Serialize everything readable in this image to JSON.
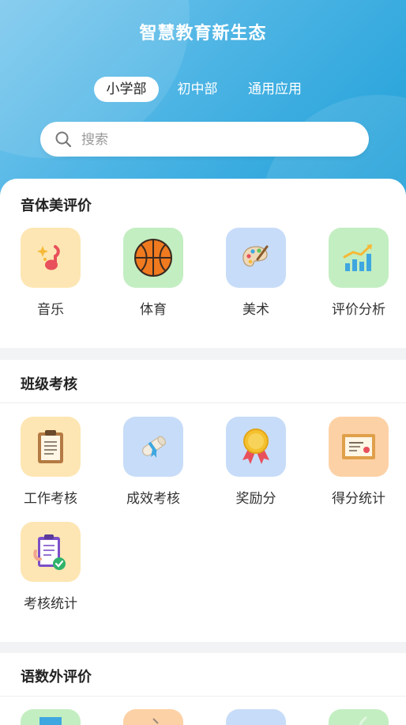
{
  "header": {
    "title": "智慧教育新生态"
  },
  "tabs": [
    {
      "label": "小学部",
      "active": true
    },
    {
      "label": "初中部",
      "active": false
    },
    {
      "label": "通用应用",
      "active": false
    }
  ],
  "search": {
    "placeholder": "搜索",
    "value": ""
  },
  "sections": [
    {
      "title": "音体美评价",
      "items": [
        {
          "label": "音乐",
          "icon": "music-note-icon",
          "bg": "#fde6b3"
        },
        {
          "label": "体育",
          "icon": "basketball-icon",
          "bg": "#c3eec1"
        },
        {
          "label": "美术",
          "icon": "palette-icon",
          "bg": "#c7dcf8"
        },
        {
          "label": "评价分析",
          "icon": "bar-chart-icon",
          "bg": "#c3eec1"
        }
      ]
    },
    {
      "title": "班级考核",
      "items": [
        {
          "label": "工作考核",
          "icon": "clipboard-icon",
          "bg": "#fde6b3"
        },
        {
          "label": "成效考核",
          "icon": "scroll-icon",
          "bg": "#c7dcf8"
        },
        {
          "label": "奖励分",
          "icon": "medal-icon",
          "bg": "#c7dcf8"
        },
        {
          "label": "得分统计",
          "icon": "certificate-icon",
          "bg": "#fdd1a6"
        },
        {
          "label": "考核统计",
          "icon": "checklist-icon",
          "bg": "#fde6b3"
        }
      ]
    },
    {
      "title": "语数外评价",
      "items": [
        {
          "icon": "book-icon",
          "bg": "#c3eec1"
        },
        {
          "icon": "pen-icon",
          "bg": "#fdd1a6"
        },
        {
          "icon": "globe-icon",
          "bg": "#c7dcf8"
        },
        {
          "icon": "leaf-icon",
          "bg": "#c3eec1"
        }
      ]
    }
  ]
}
